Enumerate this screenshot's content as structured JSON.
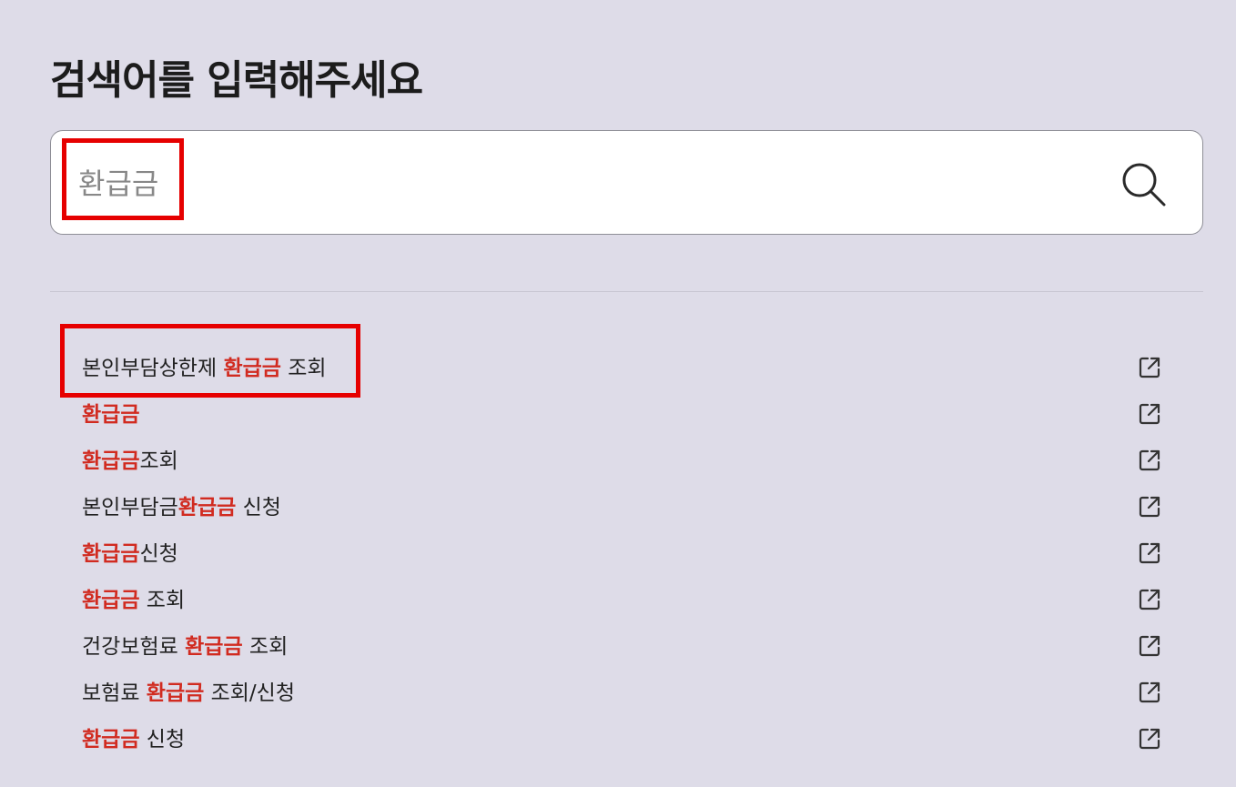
{
  "page": {
    "title": "검색어를 입력해주세요"
  },
  "search": {
    "placeholder": "환급금",
    "value": "",
    "button_icon": "search-icon"
  },
  "results": {
    "keyword_color": "#d12b20",
    "link_icon": "external-link-icon",
    "items": [
      {
        "before": "본인부담상한제 ",
        "keyword": "환급금",
        "after": " 조회"
      },
      {
        "before": "",
        "keyword": "환급금",
        "after": ""
      },
      {
        "before": "",
        "keyword": "환급금",
        "after": "조회"
      },
      {
        "before": "본인부담금",
        "keyword": "환급금",
        "after": " 신청"
      },
      {
        "before": "",
        "keyword": "환급금",
        "after": "신청"
      },
      {
        "before": "",
        "keyword": "환급금",
        "after": " 조회"
      },
      {
        "before": "건강보험료 ",
        "keyword": "환급금",
        "after": " 조회"
      },
      {
        "before": "보험료 ",
        "keyword": "환급금",
        "after": " 조회/신청"
      },
      {
        "before": "",
        "keyword": "환급금",
        "after": " 신청"
      }
    ]
  },
  "annotations": {
    "highlight_color": "#e60000"
  }
}
